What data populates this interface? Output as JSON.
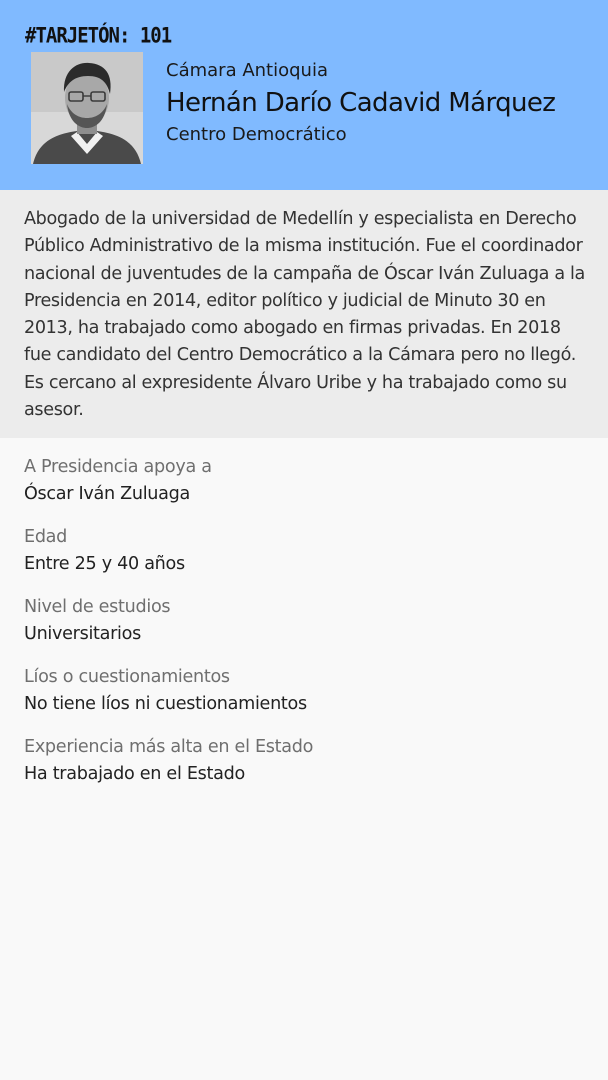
{
  "header": {
    "tag": "#TARJETÓN: 101",
    "chamber": "Cámara Antioquia",
    "name": "Hernán Darío Cadavid Márquez",
    "party": "Centro Democrático",
    "background_color": "#80baff"
  },
  "photo": {
    "icon": "candidate-portrait-photo"
  },
  "bio": {
    "text": "Abogado de la universidad de Medellín y especialista en Derecho Público Administrativo de la misma institución. Fue el coordinador nacional de juventudes de la campaña de Óscar Iván Zuluaga a la Presidencia en 2014, editor político y judicial de Minuto 30 en 2013, ha trabajado como abogado en firmas privadas. En 2018 fue candidato del Centro Democrático a la Cámara pero no llegó. Es cercano al expresidente Álvaro Uribe y ha trabajado como su asesor."
  },
  "details": [
    {
      "label": "A Presidencia apoya a",
      "value": "Óscar Iván Zuluaga"
    },
    {
      "label": "Edad",
      "value": "Entre 25 y 40 años"
    },
    {
      "label": "Nivel de estudios",
      "value": "Universitarios"
    },
    {
      "label": "Líos o cuestionamientos",
      "value": "No tiene líos ni cuestionamientos"
    },
    {
      "label": "Experiencia más alta en el Estado",
      "value": "Ha trabajado en el Estado"
    }
  ]
}
